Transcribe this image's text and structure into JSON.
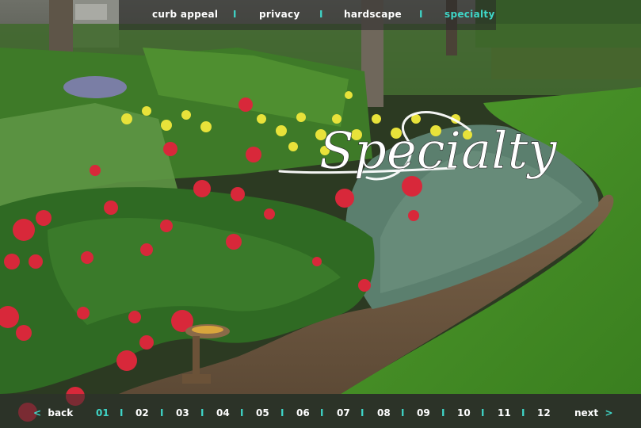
{
  "topnav": {
    "items": [
      {
        "label": "curb appeal"
      },
      {
        "label": "privacy"
      },
      {
        "label": "hardscape"
      },
      {
        "label": "specialty",
        "active": true
      }
    ],
    "separator": "I"
  },
  "title_script": "Specialty",
  "pager": {
    "back_label": "back",
    "next_label": "next",
    "back_arrow": "<",
    "next_arrow": ">",
    "separator": "I",
    "pages": [
      "01",
      "02",
      "03",
      "04",
      "05",
      "06",
      "07",
      "08",
      "09",
      "10",
      "11",
      "12"
    ],
    "current": "01"
  },
  "colors": {
    "accent": "#3fd6c8",
    "text": "#ffffff"
  }
}
